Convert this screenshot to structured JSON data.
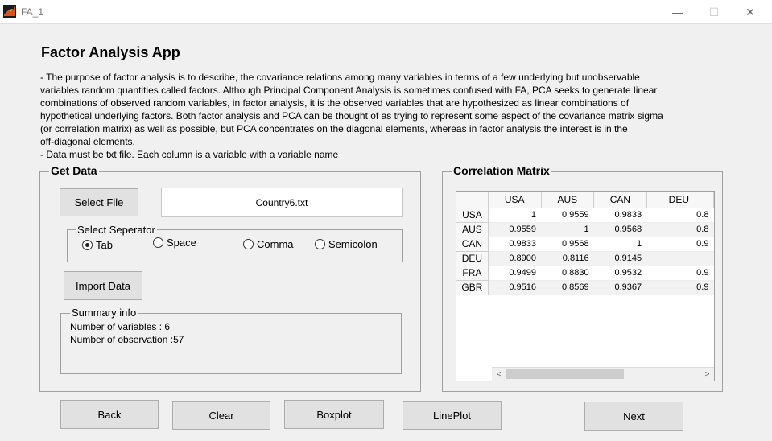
{
  "window": {
    "title": "FA_1",
    "minimize": "—",
    "maximize": "☐",
    "close": "✕"
  },
  "page": {
    "title": "Factor Analysis App",
    "description_lines": [
      "- The purpose of factor analysis is to describe, the covariance relations among many variables in terms of a few underlying but unobservable",
      "variables random quantities called factors. Although Principal Component Analysis is sometimes confused with FA, PCA seeks to generate linear",
      "combinations of observed random variables, in factor analysis, it is the observed variables that are hypothesized as linear combinations of",
      "hypothetical underlying factors. Both factor analysis and PCA can be thought of as trying to represent some aspect of the covariance matrix sigma",
      "(or correlation matrix) as well as possible, but PCA concentrates on the diagonal elements, whereas in factor analysis the interest is in the",
      "off-diagonal elements.",
      "- Data must be txt file. Each column is a variable with a variable name"
    ]
  },
  "get_data": {
    "legend": "Get Data",
    "select_file_label": "Select File",
    "file_name": "Country6.txt",
    "separator": {
      "legend": "Select Seperator",
      "options": [
        "Tab",
        "Space",
        "Comma",
        "Semicolon"
      ],
      "selected": "Tab"
    },
    "import_label": "Import Data",
    "summary": {
      "legend": "Summary info",
      "variables_line": "Number of variables   : 6",
      "observations_line": "Number of observation  :57"
    }
  },
  "correlation": {
    "legend": "Correlation Matrix",
    "columns": [
      "USA",
      "AUS",
      "CAN",
      "DEU"
    ],
    "rows": [
      {
        "name": "USA",
        "values": [
          "1",
          "0.9559",
          "0.9833",
          "0.8"
        ]
      },
      {
        "name": "AUS",
        "values": [
          "0.9559",
          "1",
          "0.9568",
          "0.8"
        ]
      },
      {
        "name": "CAN",
        "values": [
          "0.9833",
          "0.9568",
          "1",
          "0.9"
        ]
      },
      {
        "name": "DEU",
        "values": [
          "0.8900",
          "0.8116",
          "0.9145",
          ""
        ]
      },
      {
        "name": "FRA",
        "values": [
          "0.9499",
          "0.8830",
          "0.9532",
          "0.9"
        ]
      },
      {
        "name": "GBR",
        "values": [
          "0.9516",
          "0.8569",
          "0.9367",
          "0.9"
        ]
      }
    ],
    "scroll_left": "<",
    "scroll_right": ">"
  },
  "footer": {
    "back": "Back",
    "clear": "Clear",
    "boxplot": "Boxplot",
    "lineplot": "LinePlot",
    "next": "Next"
  },
  "colors": {
    "background": "#f0f0f0",
    "button": "#e1e1e1",
    "icon": "#d9541e"
  }
}
